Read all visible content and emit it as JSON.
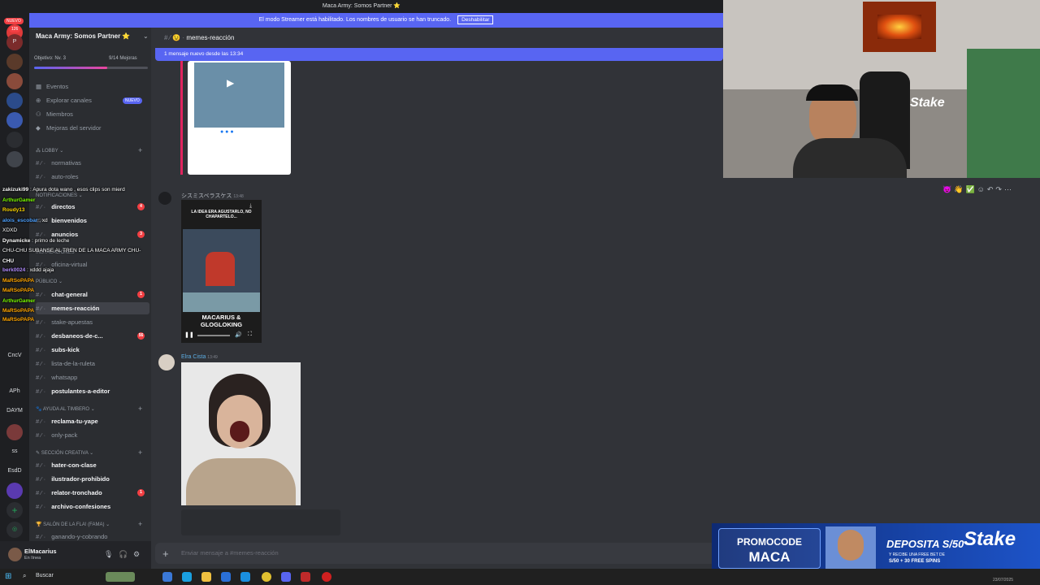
{
  "window": {
    "title": "Maca Army: Somos Partner ⭐"
  },
  "streamer_banner": {
    "text": "El modo Streamer está habilitado. Los nombres de usuario se han truncado.",
    "button": "Deshabilitar"
  },
  "server_bar": {
    "top_badge": "NUEVO",
    "badge_count": "126",
    "labels": [
      "APh",
      "DAYM",
      "EsdD",
      "CncV",
      "ss"
    ]
  },
  "server": {
    "name": "Maca Army: Somos Partner ⭐",
    "goal": "Objetivo: Nv. 3",
    "goal_progress": "9/14 Mejoras",
    "goal_fraction": 0.64
  },
  "nav": [
    {
      "label": "Eventos",
      "icon": "calendar-icon"
    },
    {
      "label": "Explorar canales",
      "icon": "compass-icon",
      "badge": "NUEVO"
    },
    {
      "label": "Miembros",
      "icon": "members-icon"
    },
    {
      "label": "Mejoras del servidor",
      "icon": "boost-icon"
    }
  ],
  "categories": {
    "lobby": "LOBBY",
    "notificaciones": "NOTIFICACIONES",
    "instalaciones": "INSTALACIONES",
    "publico": "PÚBLICO",
    "ayuda": "AYUDA AL TIMBERO",
    "creativa": "SECCIÓN CREATIVA",
    "salon": "SALÓN DE LA FLA! (FAMA)"
  },
  "channels": [
    {
      "name": "normativas",
      "unread": false
    },
    {
      "name": "auto-roles",
      "unread": false
    },
    {
      "name": "directos",
      "unread": true,
      "badge": "4"
    },
    {
      "name": "bienvenidos",
      "unread": true
    },
    {
      "name": "anuncios",
      "unread": true,
      "badge": "3"
    },
    {
      "name": "oficina-virtual",
      "unread": false
    },
    {
      "name": "chat-general",
      "unread": true,
      "badge": "1"
    },
    {
      "name": "memes-reacción",
      "unread": true,
      "selected": true
    },
    {
      "name": "stake-apuestas",
      "unread": false
    },
    {
      "name": "desbaneos-de-c...",
      "unread": true,
      "badge": "56"
    },
    {
      "name": "subs-kick",
      "unread": true
    },
    {
      "name": "lista-de-la-ruleta",
      "unread": false
    },
    {
      "name": "whatsapp",
      "unread": false
    },
    {
      "name": "postulantes-a-editor",
      "unread": true
    },
    {
      "name": "reclama-tu-yape",
      "unread": true
    },
    {
      "name": "only-pack",
      "unread": false
    },
    {
      "name": "hater-con-clase",
      "unread": true
    },
    {
      "name": "ilustrador-prohibido",
      "unread": true
    },
    {
      "name": "relator-tronchado",
      "unread": true,
      "badge": "1"
    },
    {
      "name": "archivo-confesiones",
      "unread": true
    },
    {
      "name": "ganando-y-cobrando",
      "unread": false
    }
  ],
  "chat_overlay": [
    {
      "user": "zakizuki99",
      "text": "Apura dota wano , esos clips son mierd",
      "color": "#f5f5f5"
    },
    {
      "user": "ArthurGamer",
      "text": "",
      "color": "#7cfc00"
    },
    {
      "user": "Roudy13",
      "text": "",
      "color": "#ffd700"
    },
    {
      "user": "alois_escobar",
      "text": "xd",
      "color": "#4ea1ff"
    },
    {
      "user": "",
      "text": "XDXD",
      "color": "#ff4040"
    },
    {
      "user": "Dynamicke",
      "text": "primo de leche",
      "color": "#ffffff"
    },
    {
      "user": "",
      "text": "CHU-CHU SUBANSE AL TREN DE LA MACA ARMY CHU-",
      "color": "#ffffff"
    },
    {
      "user": "CHU",
      "text": "",
      "color": "#ffffff"
    },
    {
      "user": "berk0024",
      "text": "xddd ajaja",
      "color": "#b28dff"
    },
    {
      "user": "MaRSoPAPA",
      "text": "",
      "color": "#ffa500"
    },
    {
      "user": "MaRSoPAPA",
      "text": "",
      "color": "#ffa500"
    },
    {
      "user": "ArthurGamer",
      "text": "",
      "color": "#7cfc00"
    },
    {
      "user": "MaRSoPAPA",
      "text": "",
      "color": "#ffa500"
    },
    {
      "user": "MaRSoPAPA",
      "text": "",
      "color": "#ffa500"
    }
  ],
  "header": {
    "channel": "memes-reacción"
  },
  "new_messages": "1 mensaje nuevo desde las 13:34",
  "messages": [
    {
      "author": "シスミスベラスケス",
      "time": "13:48",
      "video_caption": "LA IDEA ERA AGUSTARLO, NO CHAPARTELO...",
      "video_title": "MACARIUS & GLOGLOKING"
    },
    {
      "author": "Elra Cista",
      "time": "13:49"
    }
  ],
  "input": {
    "placeholder": "Enviar mensaje a #memes-reacción"
  },
  "user": {
    "name": "ElMacarius",
    "status": "En línea"
  },
  "taskbar": {
    "search": "Buscar",
    "date": "23/07/2025"
  },
  "promo": {
    "code_title": "PROMOCODE",
    "code": "MACA",
    "deposit": "DEPOSITA S/50",
    "line2": "Y RECIBE UNA FREE BET DE",
    "line3": "S/50 + 30 FREE SPINS",
    "brand": "Stake"
  }
}
